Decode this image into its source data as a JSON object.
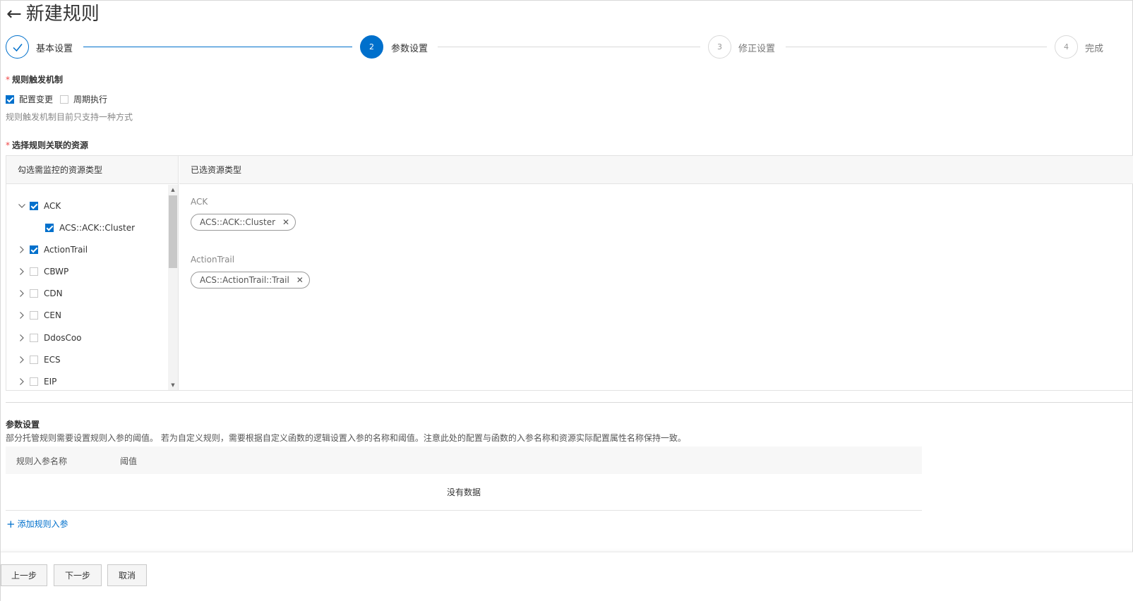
{
  "header": {
    "back_icon": "arrow-left-icon",
    "title": "新建规则"
  },
  "steps": [
    {
      "number": "",
      "label": "基本设置",
      "state": "done"
    },
    {
      "number": "2",
      "label": "参数设置",
      "state": "active"
    },
    {
      "number": "3",
      "label": "修正设置",
      "state": "pending"
    },
    {
      "number": "4",
      "label": "完成",
      "state": "pending"
    }
  ],
  "trigger": {
    "label": "规则触发机制",
    "options": [
      {
        "label": "配置变更",
        "checked": true
      },
      {
        "label": "周期执行",
        "checked": false
      }
    ],
    "hint": "规则触发机制目前只支持一种方式"
  },
  "resources": {
    "label": "选择规则关联的资源",
    "left_header": "勾选需监控的资源类型",
    "right_header": "已选资源类型",
    "tree": [
      {
        "label": "ACK",
        "expanded": true,
        "checked": true
      },
      {
        "label": "ACS::ACK::Cluster",
        "child": true,
        "checked": true
      },
      {
        "label": "ActionTrail",
        "expanded": false,
        "checked": true
      },
      {
        "label": "CBWP",
        "expanded": false,
        "checked": false
      },
      {
        "label": "CDN",
        "expanded": false,
        "checked": false
      },
      {
        "label": "CEN",
        "expanded": false,
        "checked": false
      },
      {
        "label": "DdosCoo",
        "expanded": false,
        "checked": false
      },
      {
        "label": "ECS",
        "expanded": false,
        "checked": false
      },
      {
        "label": "EIP",
        "expanded": false,
        "checked": false
      }
    ],
    "selected_groups": [
      {
        "title": "ACK",
        "tags": [
          "ACS::ACK::Cluster"
        ]
      },
      {
        "title": "ActionTrail",
        "tags": [
          "ACS::ActionTrail::Trail"
        ]
      }
    ]
  },
  "params": {
    "title": "参数设置",
    "description": "部分托管规则需要设置规则入参的阈值。 若为自定义规则，需要根据自定义函数的逻辑设置入参的名称和阈值。注意此处的配置与函数的入参名称和资源实际配置属性名称保持一致。",
    "columns": [
      "规则入参名称",
      "阈值"
    ],
    "empty_text": "没有数据",
    "add_label": "添加规则入参"
  },
  "footer": {
    "prev": "上一步",
    "next": "下一步",
    "cancel": "取消"
  },
  "colors": {
    "accent": "#0070cc",
    "required": "#f04646"
  }
}
